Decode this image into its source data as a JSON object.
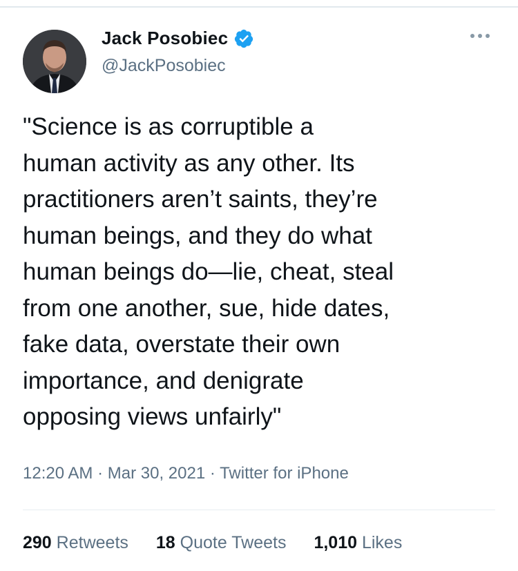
{
  "user": {
    "display_name": "Jack Posobiec",
    "handle": "@JackPosobiec",
    "verified": true,
    "verified_color": "#1da1f2"
  },
  "tweet": {
    "lines": [
      "\"Science is as corruptible a",
      "human activity as any other. Its",
      "practitioners aren’t saints, they’re",
      "human beings, and they do what",
      "human beings do—lie, cheat, steal",
      "from one another, sue, hide dates,",
      "fake data, overstate their own",
      "importance, and denigrate",
      "opposing views unfairly\""
    ],
    "time": "12:20 AM",
    "separator": "·",
    "date": "Mar 30, 2021",
    "source": "Twitter for iPhone"
  },
  "stats": {
    "retweets_count": "290",
    "retweets_label": "Retweets",
    "quote_count": "18",
    "quote_label": "Quote Tweets",
    "likes_count": "1,010",
    "likes_label": "Likes"
  },
  "icons": {
    "more": "more-horizontal-icon",
    "verified": "verified-badge-icon"
  }
}
